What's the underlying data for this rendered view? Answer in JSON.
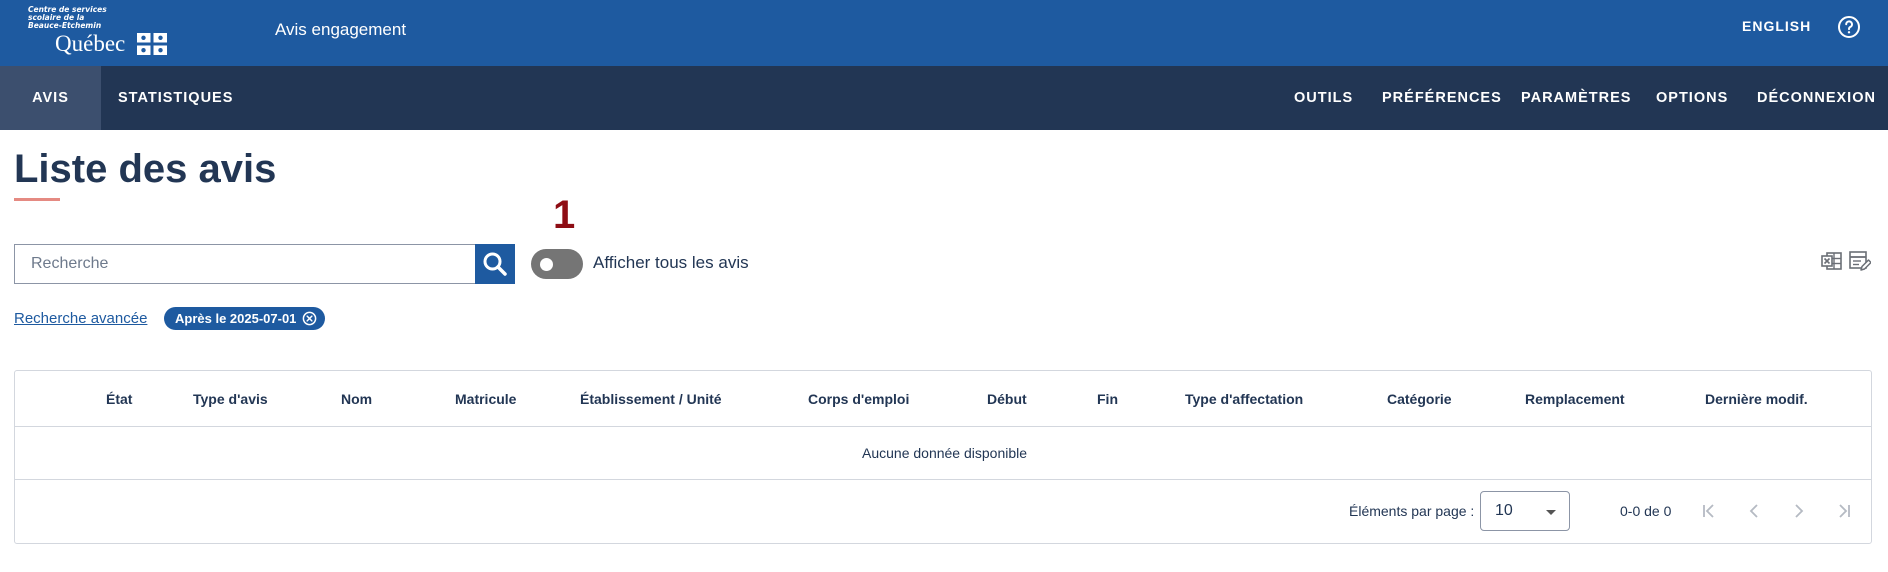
{
  "header": {
    "logo_small_lines": [
      "Centre de services",
      "scolaire de la",
      "Beauce-Etchemin"
    ],
    "logo_main": "Québec",
    "app_title": "Avis engagement",
    "language": "ENGLISH",
    "help_icon": "question-circle-icon"
  },
  "nav": {
    "left": [
      {
        "label": "AVIS",
        "active": true
      },
      {
        "label": "STATISTIQUES",
        "active": false
      }
    ],
    "right": [
      "OUTILS",
      "PRÉFÉRENCES",
      "PARAMÈTRES",
      "OPTIONS",
      "DÉCONNEXION"
    ]
  },
  "page": {
    "title": "Liste des avis",
    "step_marker": "1"
  },
  "search": {
    "placeholder": "Recherche",
    "value": "",
    "icon": "search-icon"
  },
  "toggle": {
    "label": "Afficher tous les avis",
    "on": false
  },
  "filters": {
    "advanced_link": "Recherche avancée",
    "chips": [
      "Après le 2025-07-01"
    ]
  },
  "table": {
    "columns": [
      "État",
      "Type d'avis",
      "Nom",
      "Matricule",
      "Établissement / Unité",
      "Corps d'emploi",
      "Début",
      "Fin",
      "Type d'affectation",
      "Catégorie",
      "Remplacement",
      "Dernière modif."
    ],
    "empty_text": "Aucune donnée disponible",
    "paginator": {
      "per_page_label": "Éléments par page :",
      "per_page_value": "10",
      "range": "0-0 de 0"
    }
  },
  "colors": {
    "header_blue": "#1e5aa0",
    "nav_dark": "#223654",
    "accent_underline": "#e58a82",
    "step_red": "#8e0d14"
  }
}
